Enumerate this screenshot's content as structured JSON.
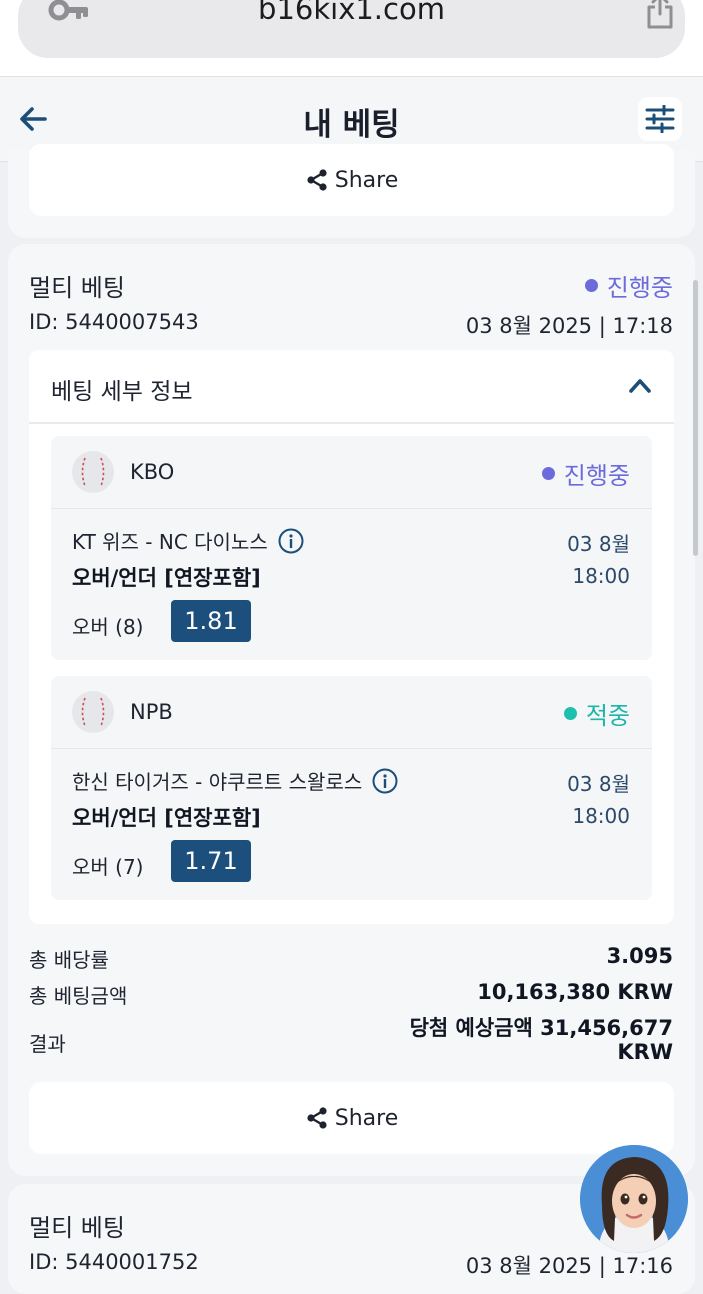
{
  "browser": {
    "url": "b16kix1.com"
  },
  "header": {
    "title": "내 베팅"
  },
  "top_card": {
    "share_label": "Share"
  },
  "bet": {
    "title": "멀티 베팅",
    "status": "진행중",
    "id_text": "ID: 5440007543",
    "datetime": "03 8월 2025 | 17:18",
    "details_title": "베팅 세부 정보",
    "legs": [
      {
        "league": "KBO",
        "status": "진행중",
        "match": "KT 위즈 - NC 다이노스",
        "market": "오버/언더 [연장포함]",
        "date": "03 8월",
        "time": "18:00",
        "selection": "오버 (8)",
        "odds": "1.81"
      },
      {
        "league": "NPB",
        "status": "적중",
        "match": "한신 타이거즈 - 야쿠르트 스왈로스",
        "market": "오버/언더 [연장포함]",
        "date": "03 8월",
        "time": "18:00",
        "selection": "오버 (7)",
        "odds": "1.71"
      }
    ],
    "summary": {
      "total_odds_label": "총 배당률",
      "total_odds_value": "3.095",
      "total_stake_label": "총 베팅금액",
      "total_stake_value": "10,163,380 KRW",
      "result_label": "결과",
      "result_value_line1": "당첨 예상금액 31,456,677",
      "result_value_line2": "KRW"
    },
    "share_label": "Share"
  },
  "next_bet": {
    "title": "멀티 베팅",
    "id_text": "ID: 5440001752",
    "datetime": "03 8월 2025 | 17:16"
  },
  "colors": {
    "live": "#6b6bdc",
    "win": "#1fbfae",
    "odds_badge": "#1c4f7c",
    "date_text": "#2b4a6a"
  },
  "icons": [
    "key-icon",
    "share-icon",
    "back-arrow-icon",
    "filter-icon",
    "chevron-up-icon",
    "baseball-icon",
    "info-icon",
    "assistant-avatar"
  ]
}
